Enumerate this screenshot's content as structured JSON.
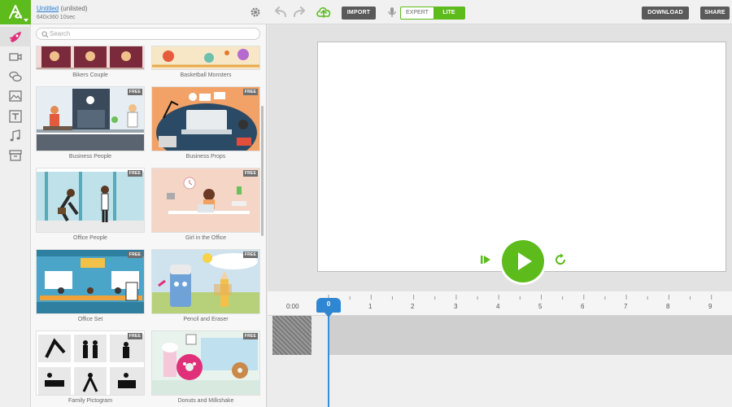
{
  "project": {
    "name": "Untitled",
    "status": "(unlisted)",
    "meta": "640x360 10sec"
  },
  "toolbar": {
    "import_label": "IMPORT",
    "mode_expert": "EXPERT",
    "mode_lite": "LITE",
    "download_label": "DOWNLOAD",
    "share_label": "SHARE"
  },
  "rail": {
    "items": [
      {
        "icon": "rocket-icon"
      },
      {
        "icon": "video-camera-icon"
      },
      {
        "icon": "speech-bubbles-icon"
      },
      {
        "icon": "image-icon"
      },
      {
        "icon": "text-icon"
      },
      {
        "icon": "music-note-icon"
      },
      {
        "icon": "archive-box-icon"
      }
    ]
  },
  "library": {
    "search_placeholder": "Search",
    "free_badge": "FREE",
    "items": [
      {
        "label": "Bikers Couple",
        "free": false
      },
      {
        "label": "Basketball Monsters",
        "free": false
      },
      {
        "label": "Business People",
        "free": true
      },
      {
        "label": "Business Props",
        "free": true
      },
      {
        "label": "Office People",
        "free": true
      },
      {
        "label": "Girl in the Office",
        "free": true
      },
      {
        "label": "Office Set",
        "free": true
      },
      {
        "label": "Pencil and Eraser",
        "free": true
      },
      {
        "label": "Family Pictogram",
        "free": true
      },
      {
        "label": "Donuts and Milkshake",
        "free": true
      }
    ]
  },
  "timeline": {
    "start_label": "0:00",
    "playhead_label": "0",
    "ticks": [
      "1",
      "2",
      "3",
      "4",
      "5",
      "6",
      "7",
      "8",
      "9"
    ]
  },
  "colors": {
    "accent": "#5dbb1b",
    "playhead": "#2f86d3",
    "dark_button": "#5a5a5a"
  }
}
